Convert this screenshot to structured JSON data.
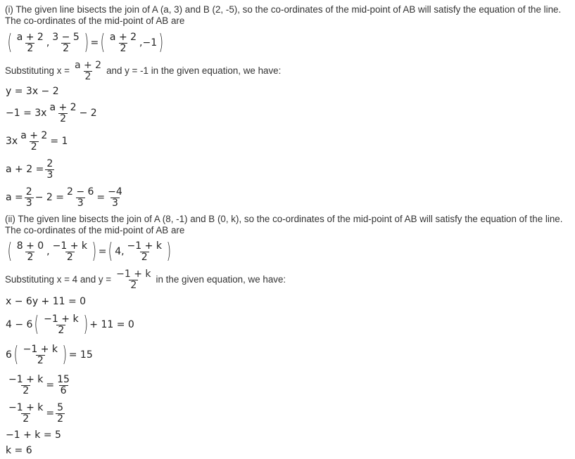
{
  "part_i": {
    "intro": "(i) The given line bisects the join of A (a, 3) and B (2, -5), so the co-ordinates of the mid-point of AB will satisfy the equation of the line.",
    "midpoint_label": "The co-ordinates of the mid-point of AB are",
    "midpoint_eq": {
      "lhs_x": {
        "num": "a + 2",
        "den": "2"
      },
      "lhs_y": {
        "num": "3 − 5",
        "den": "2"
      },
      "equals": "=",
      "rhs_x": {
        "num": "a + 2",
        "den": "2"
      },
      "rhs_y": "−1"
    },
    "substitution": {
      "prefix": "Substituting x =",
      "x_frac": {
        "num": "a + 2",
        "den": "2"
      },
      "suffix": "and y = -1 in the given equation, we have:"
    },
    "steps": [
      {
        "text": "y = 3x − 2"
      },
      {
        "pre": "−1 = 3x",
        "frac": {
          "num": "a + 2",
          "den": "2"
        },
        "post": "− 2"
      },
      {
        "pre": "3x",
        "frac": {
          "num": "a + 2",
          "den": "2"
        },
        "post": "= 1"
      },
      {
        "pre": "a + 2 =",
        "frac": {
          "num": "2",
          "den": "3"
        },
        "post": ""
      },
      {
        "pre": "a =",
        "frac": {
          "num": "2",
          "den": "3"
        },
        "mid": "− 2 =",
        "frac2": {
          "num": "2 − 6",
          "den": "3"
        },
        "mid2": "=",
        "frac3": {
          "num": "−4",
          "den": "3"
        }
      }
    ]
  },
  "part_ii": {
    "intro": "(ii) The given line bisects the join of A (8, -1) and B (0, k), so the co-ordinates of the mid-point of AB will satisfy the equation of the line.",
    "midpoint_label": "The co-ordinates of the mid-point of AB are",
    "midpoint_eq": {
      "lhs_x": {
        "num": "8 + 0",
        "den": "2"
      },
      "lhs_y": {
        "num": "−1 + k",
        "den": "2"
      },
      "equals": "=",
      "rhs_x": "4,",
      "rhs_y": {
        "num": "−1 + k",
        "den": "2"
      }
    },
    "substitution": {
      "prefix": "Substituting x = 4 and y =",
      "y_frac": {
        "num": "−1 + k",
        "den": "2"
      },
      "suffix": "in the given equation, we have:"
    },
    "steps": [
      {
        "text": "x − 6y + 11 = 0"
      },
      {
        "pre": "4 − 6",
        "frac": {
          "num": "−1 + k",
          "den": "2"
        },
        "paren": true,
        "post": "+ 11 = 0"
      },
      {
        "pre": "6",
        "frac": {
          "num": "−1 + k",
          "den": "2"
        },
        "paren": true,
        "post": "= 15"
      },
      {
        "frac": {
          "num": "−1 + k",
          "den": "2"
        },
        "mid": "=",
        "frac2": {
          "num": "15",
          "den": "6"
        }
      },
      {
        "frac": {
          "num": "−1 + k",
          "den": "2"
        },
        "mid": "=",
        "frac2": {
          "num": "5",
          "den": "2"
        }
      },
      {
        "text": "−1 + k = 5"
      },
      {
        "text": "k = 6"
      }
    ]
  }
}
